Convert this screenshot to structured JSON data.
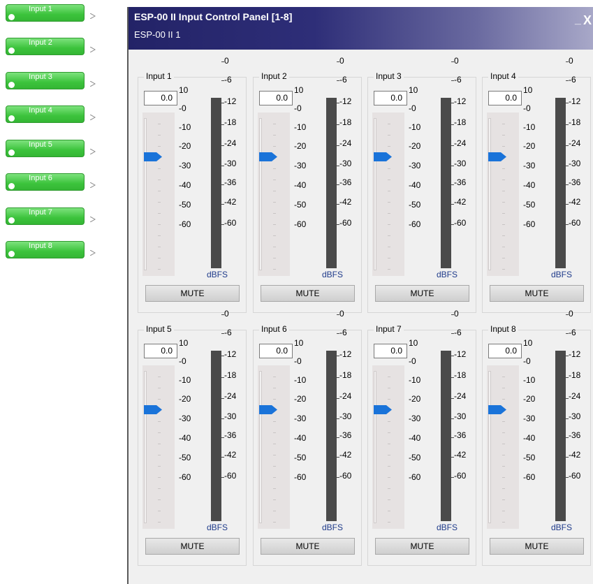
{
  "blocks": [
    {
      "label": "Input 1"
    },
    {
      "label": "Input 2"
    },
    {
      "label": "Input 3"
    },
    {
      "label": "Input 4"
    },
    {
      "label": "Input 5"
    },
    {
      "label": "Input 6"
    },
    {
      "label": "Input 7"
    },
    {
      "label": "Input 8"
    }
  ],
  "window": {
    "title": "ESP-00 II Input Control Panel [1-8]",
    "subtitle": "ESP-00 II 1",
    "minimize_label": "_",
    "close_label": "X"
  },
  "fader_scale": [
    "10",
    "-0",
    "-10",
    "-20",
    "-30",
    "-40",
    "-50",
    "-60"
  ],
  "meter_scale": [
    "0",
    "-6",
    "-12",
    "-18",
    "-24",
    "-30",
    "-36",
    "-42",
    "-60"
  ],
  "meter_unit": "dBFS",
  "channels": [
    {
      "label": "Input 1",
      "value": "0.0",
      "mute": "MUTE"
    },
    {
      "label": "Input 2",
      "value": "0.0",
      "mute": "MUTE"
    },
    {
      "label": "Input 3",
      "value": "0.0",
      "mute": "MUTE"
    },
    {
      "label": "Input 4",
      "value": "0.0",
      "mute": "MUTE"
    },
    {
      "label": "Input 5",
      "value": "0.0",
      "mute": "MUTE"
    },
    {
      "label": "Input 6",
      "value": "0.0",
      "mute": "MUTE"
    },
    {
      "label": "Input 7",
      "value": "0.0",
      "mute": "MUTE"
    },
    {
      "label": "Input 8",
      "value": "0.0",
      "mute": "MUTE"
    }
  ],
  "colors": {
    "block_green": "#3cc33c",
    "title_bar": "#232367",
    "fader_thumb": "#1a73d9",
    "meter": "#4a4a4a",
    "dbfs_text": "#1e3a8a"
  }
}
